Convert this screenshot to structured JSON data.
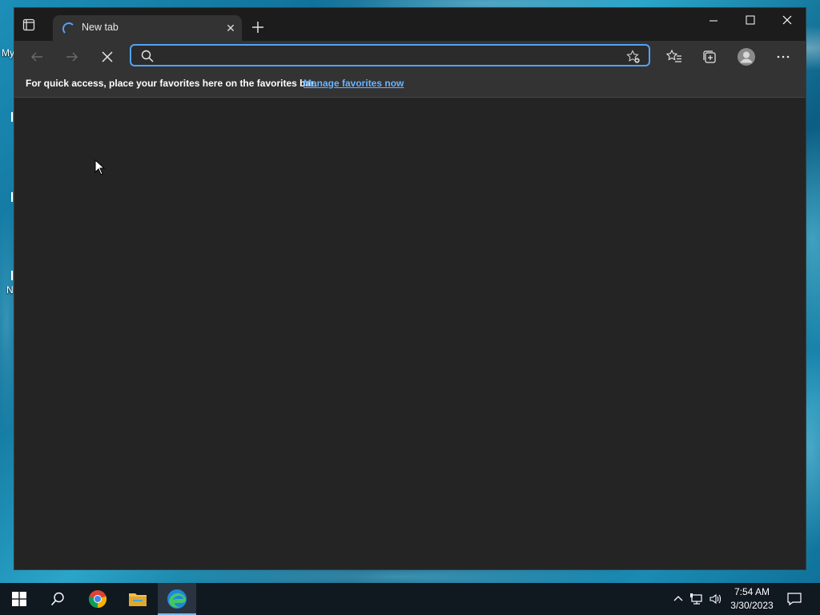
{
  "desktop": {
    "labels": [
      "My",
      "N"
    ]
  },
  "browser": {
    "tab": {
      "title": "New tab",
      "loading": true
    },
    "address_bar": {
      "value": "",
      "placeholder": ""
    },
    "favorites_bar": {
      "message": "For quick access, place your favorites here on the favorites bar.",
      "link": "Manage favorites now"
    },
    "icons": {
      "tab_actions": "tab-actions-icon",
      "back": "arrow-left-icon",
      "forward": "arrow-right-icon",
      "stop": "close-icon",
      "favorites": "favorites-star-icon",
      "collections": "collections-icon",
      "profile": "profile-avatar-icon",
      "more": "ellipsis-icon"
    },
    "colors": {
      "accent": "#4fa3f7",
      "link": "#69b4ff",
      "frame": "#1c1c1c",
      "toolbar": "#333334",
      "page": "#242424"
    }
  },
  "taskbar": {
    "apps": [
      "start-icon",
      "search-icon",
      "chrome-icon",
      "file-explorer-icon",
      "edge-icon"
    ],
    "active_app": "edge-icon",
    "clock": {
      "time": "7:54 AM",
      "date": "3/30/2023"
    }
  }
}
